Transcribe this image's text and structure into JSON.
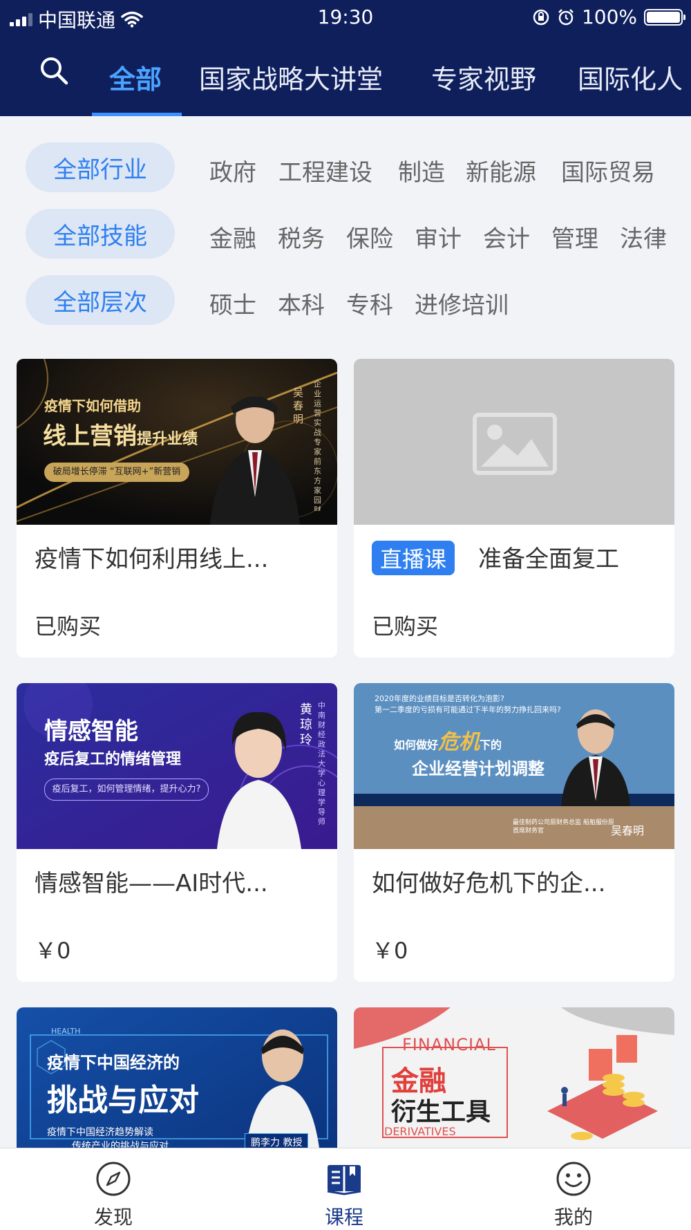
{
  "status_bar": {
    "carrier": "中国联通",
    "time": "19:30",
    "battery": "100%"
  },
  "tabs": [
    {
      "label": "全部",
      "active": true
    },
    {
      "label": "国家战略大讲堂"
    },
    {
      "label": "专家视野"
    },
    {
      "label": "国际化人"
    }
  ],
  "filters": {
    "industry": {
      "all": "全部行业",
      "items": [
        "政府",
        "工程建设",
        "制造",
        "新能源",
        "国际贸易"
      ]
    },
    "skill": {
      "all": "全部技能",
      "items": [
        "金融",
        "税务",
        "保险",
        "审计",
        "会计",
        "管理",
        "法律"
      ]
    },
    "level": {
      "all": "全部层次",
      "items": [
        "硕士",
        "本科",
        "专科",
        "进修培训"
      ]
    }
  },
  "courses": [
    {
      "title": "疫情下如何利用线上...",
      "meta": "已购买",
      "banner": {
        "line1": "疫情下如何借助",
        "line2a": "线上营销",
        "line2b": "提升业绩",
        "tag": "破局增长停滞 “互联网+”新营销",
        "name": "吴春明",
        "side": "企业运营实战专家 前东方家园财务总监"
      }
    },
    {
      "badge": "直播课",
      "title": "准备全面复工",
      "meta": "已购买"
    },
    {
      "title": "情感智能——AI时代...",
      "meta": "￥0",
      "banner": {
        "line1": "情感智能",
        "line2": "疫后复工的情绪管理",
        "tag": "疫后复工，如何管理情绪，提升心力?",
        "name": "黄琼玲",
        "side": "中南财经政法大学 心理学导师"
      }
    },
    {
      "title": "如何做好危机下的企...",
      "meta": "￥0",
      "banner": {
        "top1": "2020年度的业绩目标是否转化为泡影?",
        "top2": "第一二季度的亏损有可能通过下半年的努力挣扎回来吗?",
        "line1a": "如何做好",
        "line1b": "危机",
        "line1c": "下的",
        "line2": "企业经营计划调整",
        "bottom": "最佳制药公司原财务总监 船舶服份原首席财务官",
        "name": "吴春明"
      }
    },
    {
      "banner": {
        "health": "HEALTH",
        "line1": "疫情下中国经济的",
        "line2": "挑战与应对",
        "sub1": "疫情下中国经济趋势解读",
        "sub2": "传统产业的挑战与应对",
        "name": "鹏李力 教授"
      }
    },
    {
      "banner": {
        "en1": "FINANCIAL",
        "line1": "金融",
        "line2": "衍生工具",
        "en2": "DERIVATIVES"
      }
    }
  ],
  "bottom_nav": [
    {
      "label": "发现",
      "icon": "compass-icon"
    },
    {
      "label": "课程",
      "icon": "book-icon",
      "active": true
    },
    {
      "label": "我的",
      "icon": "smiley-icon"
    }
  ],
  "colors": {
    "header": "#0f1f5c",
    "accent": "#2f7ff0",
    "pill_bg": "#dce6f5",
    "page_bg": "#f2f3f7"
  }
}
